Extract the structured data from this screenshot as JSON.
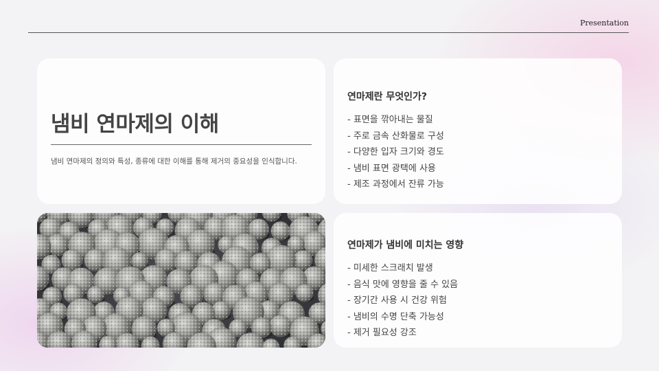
{
  "header": {
    "label": "Presentation"
  },
  "intro": {
    "title": "냄비 연마제의 이해",
    "description": "냄비 연마제의 정의와 특성, 종류에 대한 이해를 통해 제거의 중요성을 인식합니다."
  },
  "what_is": {
    "title": "연마제란 무엇인가?",
    "items": [
      "- 표면을 깎아내는 물질",
      "- 주로 금속 산화물로 구성",
      "- 다양한 입자 크기와 경도",
      "- 냄비 표면 광택에 사용",
      "- 제조 과정에서 잔류 가능"
    ]
  },
  "effects": {
    "title": "연마제가 냄비에 미치는 영향",
    "items": [
      "- 미세한 스크래치 발생",
      "- 음식 맛에 영향을 줄 수 있음",
      "- 장기간 사용 시 건강 위험",
      "- 냄비의 수명 단축 가능성",
      "- 제거 필요성 강조"
    ]
  },
  "image": {
    "subject": "spiky-spheres-photo"
  },
  "colors": {
    "background": "#f3f2f4",
    "card": "#ffffff",
    "text": "#333333",
    "photo_bg": "#3a3b3f"
  }
}
